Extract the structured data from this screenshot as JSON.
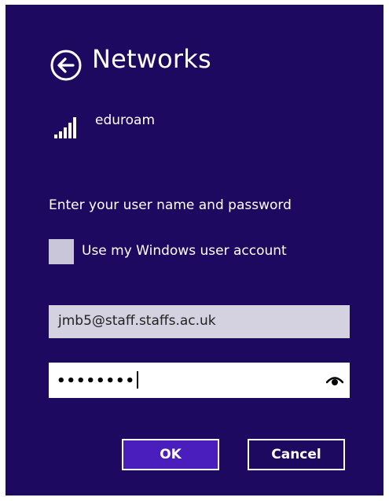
{
  "header": {
    "title": "Networks",
    "back_icon": "back-arrow-icon"
  },
  "network": {
    "name": "eduroam",
    "signal_icon": "wifi-signal-icon"
  },
  "form": {
    "prompt": "Enter your user name and password",
    "use_windows_account_label": "Use my Windows user account",
    "use_windows_account_checked": false,
    "username_value": "jmb5@staff.staffs.ac.uk",
    "password_mask": "••••••••",
    "reveal_icon": "eye-icon"
  },
  "buttons": {
    "ok_label": "OK",
    "cancel_label": "Cancel"
  },
  "colors": {
    "background": "#1d0960",
    "accent": "#4a1ebc",
    "checkbox": "#c9c6d9",
    "username_field": "#d4d1e0"
  }
}
